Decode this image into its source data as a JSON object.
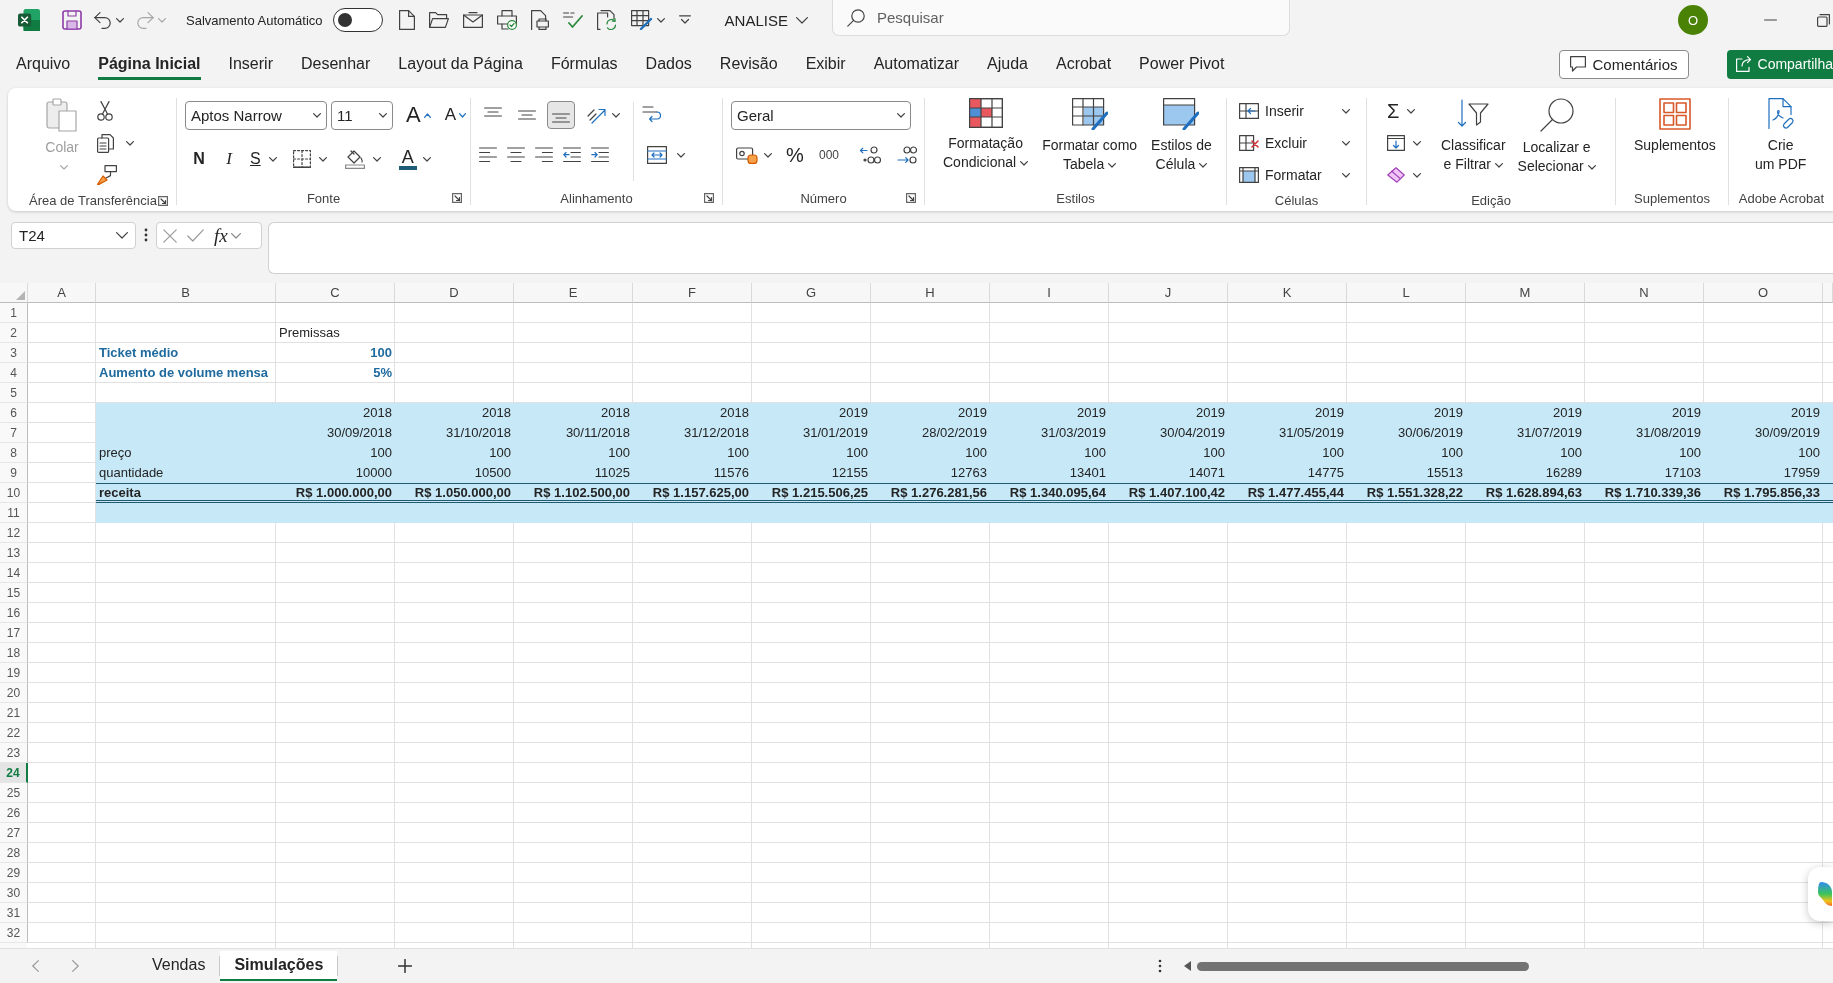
{
  "title_bar": {
    "redo_disabled": true,
    "autosave": {
      "label": "Salvamento Automático",
      "on": false
    },
    "file_name": "ANALISE",
    "search": {
      "placeholder": "Pesquisar"
    },
    "account_initial": "O"
  },
  "tabs": [
    {
      "label": "Arquivo",
      "selected": false
    },
    {
      "label": "Página Inicial",
      "selected": true
    },
    {
      "label": "Inserir",
      "selected": false
    },
    {
      "label": "Desenhar",
      "selected": false
    },
    {
      "label": "Layout da Página",
      "selected": false
    },
    {
      "label": "Fórmulas",
      "selected": false
    },
    {
      "label": "Dados",
      "selected": false
    },
    {
      "label": "Revisão",
      "selected": false
    },
    {
      "label": "Exibir",
      "selected": false
    },
    {
      "label": "Automatizar",
      "selected": false
    },
    {
      "label": "Ajuda",
      "selected": false
    },
    {
      "label": "Acrobat",
      "selected": false
    },
    {
      "label": "Power Pivot",
      "selected": false
    }
  ],
  "comments_button": "Comentários",
  "share_button": "Compartilha",
  "ribbon": {
    "clipboard": {
      "label": "Área de Transferência",
      "launcher": true,
      "paste": {
        "label": "Colar",
        "disabled": true
      }
    },
    "font": {
      "label": "Fonte",
      "launcher": true,
      "font_name": "Aptos Narrow",
      "font_size": "11",
      "grow": "A",
      "shrink": "A",
      "bold": "N",
      "italic": "I",
      "underline": "S",
      "font_color": "A"
    },
    "alignment": {
      "label": "Alinhamento",
      "launcher": true,
      "vertical": [
        {
          "selected": false
        },
        {
          "selected": false
        },
        {
          "selected": true
        }
      ]
    },
    "number": {
      "label": "Número",
      "launcher": true,
      "format": "Geral",
      "percent": "%",
      "thousands": "000"
    },
    "styles": {
      "label": "Estilos",
      "launcher": false,
      "buttons": [
        [
          "Formatação",
          "Condicional"
        ],
        [
          "Formatar como",
          "Tabela"
        ],
        [
          "Estilos de",
          "Célula"
        ]
      ]
    },
    "cells": {
      "label": "Células",
      "launcher": false,
      "buttons": [
        "Inserir",
        "Excluir",
        "Formatar"
      ]
    },
    "editing": {
      "label": "Edição",
      "launcher": false,
      "autosum": "Σ",
      "sort": [
        "Classificar",
        "e Filtrar"
      ],
      "find": [
        "Localizar e",
        "Selecionar"
      ]
    },
    "addins": {
      "label": "Suplementos",
      "launcher": false,
      "button": [
        "Suplementos"
      ]
    },
    "acrobat": {
      "label": "Adobe Acrobat",
      "launcher": false,
      "button": [
        "Crie",
        "um PDF"
      ]
    }
  },
  "formula_bar": {
    "name_box": "T24",
    "function_label": "fx"
  },
  "sheet": {
    "columns": [
      "A",
      "B",
      "C",
      "D",
      "E",
      "F",
      "G",
      "H",
      "I",
      "J",
      "K",
      "L",
      "M",
      "N",
      "O"
    ],
    "rows": [
      {
        "number": "1",
        "selected": false,
        "kind": "blank"
      },
      {
        "number": "2",
        "selected": false,
        "kind": "note",
        "values": [
          "Premissas"
        ]
      },
      {
        "number": "3",
        "selected": false,
        "kind": "input",
        "label": "Ticket médio",
        "values": [
          "100"
        ]
      },
      {
        "number": "4",
        "selected": false,
        "kind": "input",
        "label": "Aumento de volume mensa",
        "values": [
          "5%"
        ]
      },
      {
        "number": "5",
        "selected": false,
        "kind": "blank"
      },
      {
        "number": "6",
        "selected": false,
        "kind": "band",
        "values": [
          "2018",
          "2018",
          "2018",
          "2018",
          "2019",
          "2019",
          "2019",
          "2019",
          "2019",
          "2019",
          "2019",
          "2019",
          "2019"
        ]
      },
      {
        "number": "7",
        "selected": false,
        "kind": "band",
        "values": [
          "30/09/2018",
          "31/10/2018",
          "30/11/2018",
          "31/12/2018",
          "31/01/2019",
          "28/02/2019",
          "31/03/2019",
          "30/04/2019",
          "31/05/2019",
          "30/06/2019",
          "31/07/2019",
          "31/08/2019",
          "30/09/2019"
        ]
      },
      {
        "number": "8",
        "selected": false,
        "kind": "band",
        "label": "preço",
        "values": [
          "100",
          "100",
          "100",
          "100",
          "100",
          "100",
          "100",
          "100",
          "100",
          "100",
          "100",
          "100",
          "100"
        ]
      },
      {
        "number": "9",
        "selected": false,
        "kind": "band",
        "label": "quantidade",
        "values": [
          "10000",
          "10500",
          "11025",
          "11576",
          "12155",
          "12763",
          "13401",
          "14071",
          "14775",
          "15513",
          "16289",
          "17103",
          "17959"
        ]
      },
      {
        "number": "10",
        "selected": false,
        "kind": "total",
        "label": "receita",
        "values": [
          "R$ 1.000.000,00",
          "R$ 1.050.000,00",
          "R$ 1.102.500,00",
          "R$ 1.157.625,00",
          "R$ 1.215.506,25",
          "R$ 1.276.281,56",
          "R$ 1.340.095,64",
          "R$ 1.407.100,42",
          "R$ 1.477.455,44",
          "R$ 1.551.328,22",
          "R$ 1.628.894,63",
          "R$ 1.710.339,36",
          "R$ 1.795.856,33"
        ]
      },
      {
        "number": "11",
        "selected": false,
        "kind": "band"
      },
      {
        "number": "12",
        "selected": false,
        "kind": "blank"
      },
      {
        "number": "13",
        "selected": false,
        "kind": "blank"
      },
      {
        "number": "14",
        "selected": false,
        "kind": "blank"
      },
      {
        "number": "15",
        "selected": false,
        "kind": "blank"
      },
      {
        "number": "16",
        "selected": false,
        "kind": "blank"
      },
      {
        "number": "17",
        "selected": false,
        "kind": "blank"
      },
      {
        "number": "18",
        "selected": false,
        "kind": "blank"
      },
      {
        "number": "19",
        "selected": false,
        "kind": "blank"
      },
      {
        "number": "20",
        "selected": false,
        "kind": "blank"
      },
      {
        "number": "21",
        "selected": false,
        "kind": "blank"
      },
      {
        "number": "22",
        "selected": false,
        "kind": "blank"
      },
      {
        "number": "23",
        "selected": false,
        "kind": "blank"
      },
      {
        "number": "24",
        "selected": true,
        "kind": "blank"
      },
      {
        "number": "25",
        "selected": false,
        "kind": "blank"
      },
      {
        "number": "26",
        "selected": false,
        "kind": "blank"
      },
      {
        "number": "27",
        "selected": false,
        "kind": "blank"
      },
      {
        "number": "28",
        "selected": false,
        "kind": "blank"
      },
      {
        "number": "29",
        "selected": false,
        "kind": "blank"
      },
      {
        "number": "30",
        "selected": false,
        "kind": "blank"
      },
      {
        "number": "31",
        "selected": false,
        "kind": "blank"
      },
      {
        "number": "32",
        "selected": false,
        "kind": "blank"
      }
    ]
  },
  "sheet_tabs": [
    {
      "label": "Vendas",
      "selected": false
    },
    {
      "label": "Simulações",
      "selected": true
    }
  ]
}
